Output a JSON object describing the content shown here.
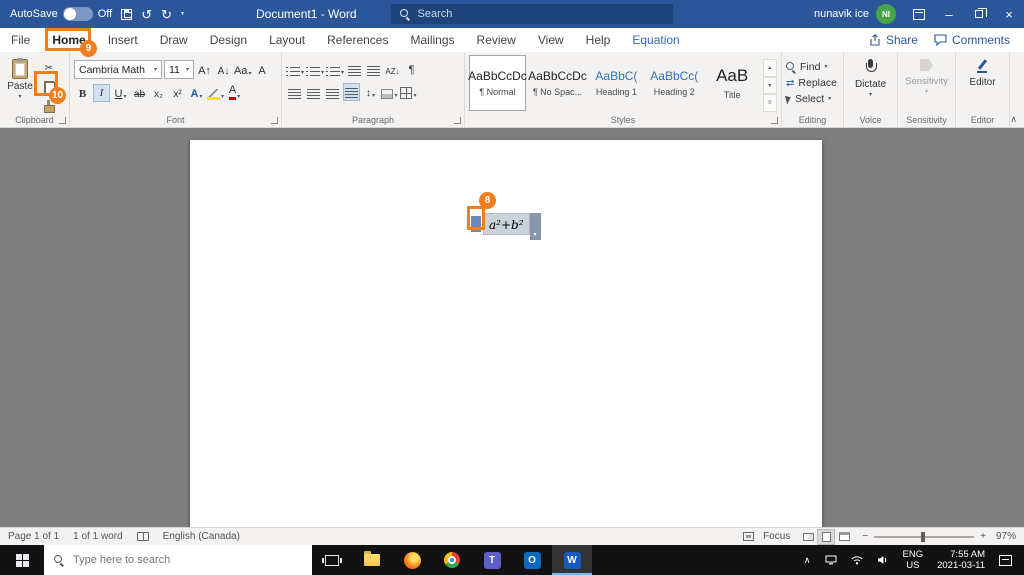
{
  "titlebar": {
    "autosave_label": "AutoSave",
    "autosave_state": "Off",
    "doc_title": "Document1 - Word",
    "search_placeholder": "Search",
    "user_name": "nunavik ice",
    "user_initials": "NI"
  },
  "tabs": {
    "items": [
      "File",
      "Home",
      "Insert",
      "Draw",
      "Design",
      "Layout",
      "References",
      "Mailings",
      "Review",
      "View",
      "Help",
      "Equation"
    ],
    "share": "Share",
    "comments": "Comments"
  },
  "ribbon": {
    "clipboard": {
      "paste": "Paste",
      "label": "Clipboard"
    },
    "font": {
      "name": "Cambria Math",
      "size": "11",
      "label": "Font"
    },
    "para": {
      "label": "Paragraph"
    },
    "styles": {
      "label": "Styles",
      "cards": [
        {
          "p": "AaBbCcDc",
          "n": "¶ Normal"
        },
        {
          "p": "AaBbCcDc",
          "n": "¶ No Spac..."
        },
        {
          "p": "AaBbC(",
          "n": "Heading 1"
        },
        {
          "p": "AaBbCc(",
          "n": "Heading 2"
        },
        {
          "p": "AaB",
          "n": "Title"
        }
      ]
    },
    "editing": {
      "find": "Find",
      "replace": "Replace",
      "select": "Select",
      "label": "Editing"
    },
    "voice": {
      "dictate": "Dictate",
      "label": "Voice"
    },
    "sens": {
      "btn": "Sensitivity",
      "label": "Sensitivity"
    },
    "editor": {
      "btn": "Editor",
      "label": "Editor"
    }
  },
  "doc": {
    "equation": "a²+b²"
  },
  "annotations": {
    "n8": "8",
    "n9": "9",
    "n10": "10"
  },
  "statusbar": {
    "page": "Page 1 of 1",
    "words": "1 of 1 word",
    "language": "English (Canada)",
    "focus": "Focus",
    "zoom": "97%"
  },
  "taskbar": {
    "search_placeholder": "Type here to search",
    "teams_letter": "T",
    "outlook_letter": "O",
    "word_letter": "W",
    "lang1": "ENG",
    "lang2": "US",
    "time": "7:55 AM",
    "date": "2021-03-11"
  },
  "g": {
    "chev": "▾",
    "collapse": "∧",
    "tray_chev": "∧",
    "undo": "↺",
    "redo": "↻",
    "close": "×",
    "minimize": "–",
    "pil": "¶",
    "bold": "B",
    "italic": "I",
    "underline": "U",
    "strike": "ab",
    "sub": "x₂",
    "sup": "x²",
    "caseAa": "Aa",
    "growA": "A↑",
    "shrinkA": "A↓",
    "clearA": "A",
    "effectsA": "A",
    "fontA": "A",
    "cut": "✂",
    "sort": "AZ↓",
    "updown": "↕",
    "scroll_up": "▴",
    "scroll_down": "▾",
    "more": "≡",
    "minus": "−",
    "plus": "+",
    "replace_ic": "⇄"
  },
  "colors": {
    "titlebar_blue": "#2b579a",
    "annotation_orange": "#f07d1e",
    "document_bg": "#7e7e7e",
    "taskbar_black": "#121212",
    "contextual_tab_blue": "#2f6bc0"
  }
}
